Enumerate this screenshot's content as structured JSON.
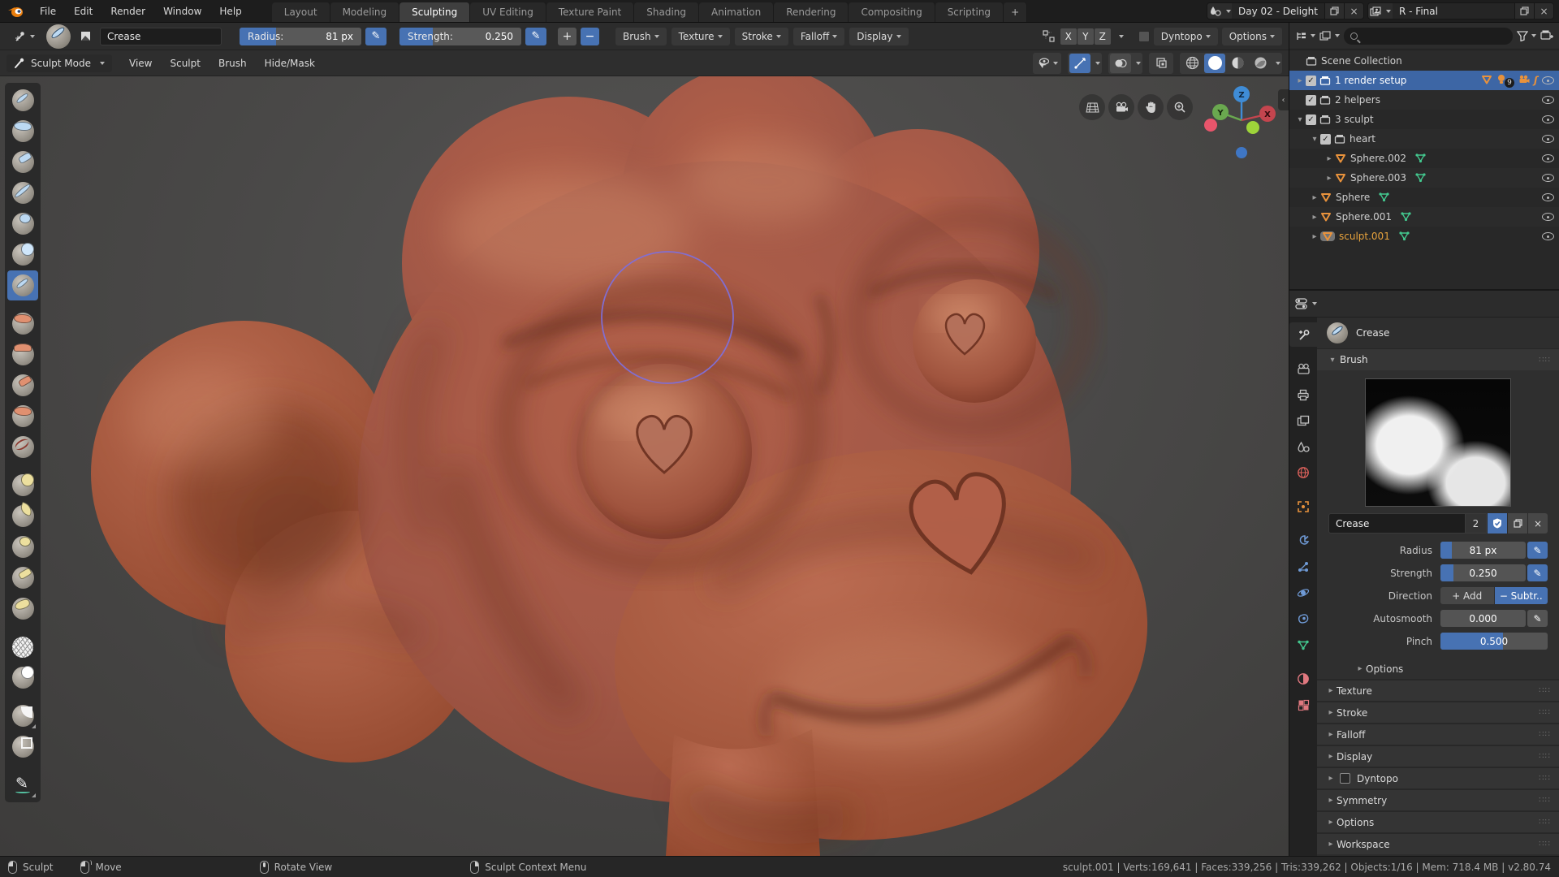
{
  "colors": {
    "accent": "#4772b3",
    "selection_row": "#3d66a5",
    "object_orange": "#e8923c",
    "data_green": "#43c78e",
    "active_text": "#e8a33d",
    "cursor_purple": "#7f6fd8",
    "skin_base": "#a25847",
    "skin_shadow": "#6e3322",
    "skin_light": "#c07a5e"
  },
  "topbar": {
    "menus": [
      "File",
      "Edit",
      "Render",
      "Window",
      "Help"
    ],
    "tabs": [
      {
        "label": "Layout",
        "active": false
      },
      {
        "label": "Modeling",
        "active": false
      },
      {
        "label": "Sculpting",
        "active": true
      },
      {
        "label": "UV Editing",
        "active": false
      },
      {
        "label": "Texture Paint",
        "active": false
      },
      {
        "label": "Shading",
        "active": false
      },
      {
        "label": "Animation",
        "active": false
      },
      {
        "label": "Rendering",
        "active": false
      },
      {
        "label": "Compositing",
        "active": false
      },
      {
        "label": "Scripting",
        "active": false
      }
    ],
    "add_tab_label": "+",
    "scene": {
      "label": "Day 02 - Delight"
    },
    "view_layer": {
      "label": "R - Final"
    }
  },
  "tool_settings": {
    "brush_name": "Crease",
    "radius_label": "Radius:",
    "radius_value": "81 px",
    "radius_fill": 0.3,
    "strength_label": "Strength:",
    "strength_value": "0.250",
    "strength_fill": 0.27,
    "add_label": "+",
    "subtract_label": "−",
    "popovers": [
      "Brush",
      "Texture",
      "Stroke",
      "Falloff",
      "Display"
    ],
    "axis_toggles": [
      "X",
      "Y",
      "Z"
    ],
    "dyntopo_label": "Dyntopo",
    "options_label": "Options"
  },
  "viewport_header": {
    "mode_label": "Sculpt Mode",
    "menus": [
      "View",
      "Sculpt",
      "Brush",
      "Hide/Mask"
    ]
  },
  "toolbar": {
    "tools": [
      {
        "name": "draw",
        "kind": "stripe",
        "color": "#bcd9f2",
        "active": false,
        "gap": false
      },
      {
        "name": "clay",
        "kind": "crumple",
        "color": "#bcd9f2",
        "active": false,
        "gap": false
      },
      {
        "name": "clay-strips",
        "kind": "strips",
        "color": "#bcd9f2",
        "active": false,
        "gap": false
      },
      {
        "name": "layer",
        "kind": "band",
        "color": "#bcd9f2",
        "active": false,
        "gap": false
      },
      {
        "name": "inflate",
        "kind": "blobtop",
        "color": "#bcd9f2",
        "active": false,
        "gap": false
      },
      {
        "name": "blob",
        "kind": "bloright",
        "color": "#cfe6fa",
        "active": false,
        "gap": false
      },
      {
        "name": "crease",
        "kind": "stripe",
        "color": "#bcd9f2",
        "active": true,
        "gap": false
      },
      {
        "name": "smooth",
        "kind": "crumple",
        "color": "#e09070",
        "active": false,
        "gap": true
      },
      {
        "name": "flatten",
        "kind": "cap",
        "color": "#e09070",
        "active": false,
        "gap": false
      },
      {
        "name": "fill",
        "kind": "strips",
        "color": "#e09070",
        "active": false,
        "gap": false
      },
      {
        "name": "scrape",
        "kind": "crumple",
        "color": "#e09070",
        "active": false,
        "gap": false
      },
      {
        "name": "pinch",
        "kind": "lines",
        "color": "#8c3a30",
        "active": false,
        "gap": false
      },
      {
        "name": "grab",
        "kind": "bloright",
        "color": "#ecdf9e",
        "active": false,
        "gap": true
      },
      {
        "name": "snake-hook",
        "kind": "point",
        "color": "#ecdf9e",
        "active": false,
        "gap": false
      },
      {
        "name": "thumb",
        "kind": "blobtop",
        "color": "#ecdf9e",
        "active": false,
        "gap": false
      },
      {
        "name": "nudge",
        "kind": "strips",
        "color": "#ecdf9e",
        "active": false,
        "gap": false
      },
      {
        "name": "rotate",
        "kind": "swirl",
        "color": "#ecdf9e",
        "active": false,
        "gap": false
      },
      {
        "name": "simplify",
        "kind": "web",
        "color": "#f0f0f0",
        "active": false,
        "gap": true
      },
      {
        "name": "mask",
        "kind": "bloright",
        "color": "#ffffff",
        "active": false,
        "gap": false
      },
      {
        "name": "box-hide",
        "kind": "boxfill",
        "color": "#f5f5f5",
        "active": false,
        "gap": true,
        "submenu": true
      },
      {
        "name": "box-mask",
        "kind": "boxline",
        "color": "#f5f5f5",
        "active": false,
        "gap": false
      },
      {
        "name": "annotate",
        "kind": "pen",
        "color": "#54c0a0",
        "active": false,
        "gap": true,
        "submenu": true
      }
    ]
  },
  "gizmo": {
    "x_label": "X",
    "y_label": "Y",
    "z_label": "Z"
  },
  "outliner": {
    "search_placeholder": "",
    "rows": [
      {
        "indent": 0,
        "expander": "",
        "checkbox": false,
        "icon": "collection",
        "label": "Scene Collection",
        "selected": false,
        "active": false,
        "datamesh": false,
        "badges": false,
        "eye": false
      },
      {
        "indent": 0,
        "expander": "right",
        "checkbox": true,
        "icon": "collection",
        "label": "1 render setup",
        "selected": true,
        "active": false,
        "datamesh": false,
        "badges": true,
        "eye": true
      },
      {
        "indent": 0,
        "expander": "",
        "checkbox": true,
        "icon": "collection",
        "label": "2 helpers",
        "selected": false,
        "active": false,
        "datamesh": false,
        "badges": false,
        "eye": true
      },
      {
        "indent": 0,
        "expander": "down",
        "checkbox": true,
        "icon": "collection",
        "label": "3 sculpt",
        "selected": false,
        "active": false,
        "datamesh": false,
        "badges": false,
        "eye": true
      },
      {
        "indent": 1,
        "expander": "down",
        "checkbox": true,
        "icon": "collection",
        "label": "heart",
        "selected": false,
        "active": false,
        "datamesh": false,
        "badges": false,
        "eye": true
      },
      {
        "indent": 2,
        "expander": "right",
        "checkbox": false,
        "icon": "mesh",
        "label": "Sphere.002",
        "selected": false,
        "active": false,
        "datamesh": true,
        "badges": false,
        "eye": true
      },
      {
        "indent": 2,
        "expander": "right",
        "checkbox": false,
        "icon": "mesh",
        "label": "Sphere.003",
        "selected": false,
        "active": false,
        "datamesh": true,
        "badges": false,
        "eye": true
      },
      {
        "indent": 1,
        "expander": "right",
        "checkbox": false,
        "icon": "mesh",
        "label": "Sphere",
        "selected": false,
        "active": false,
        "datamesh": true,
        "badges": false,
        "eye": true
      },
      {
        "indent": 1,
        "expander": "right",
        "checkbox": false,
        "icon": "mesh",
        "label": "Sphere.001",
        "selected": false,
        "active": false,
        "datamesh": true,
        "badges": false,
        "eye": true
      },
      {
        "indent": 1,
        "expander": "right",
        "checkbox": false,
        "icon": "mesh-active",
        "label": "sculpt.001",
        "selected": false,
        "active": true,
        "datamesh": true,
        "badges": false,
        "eye": true
      }
    ],
    "light_badge_count": "9"
  },
  "properties": {
    "breadcrumb": "Crease",
    "tabs": [
      {
        "name": "tool",
        "active": true,
        "color": "#d8d8d8",
        "spaced": false
      },
      {
        "name": "render",
        "active": false,
        "color": "#bfbfbf",
        "spaced": true
      },
      {
        "name": "output",
        "active": false,
        "color": "#bfbfbf",
        "spaced": false
      },
      {
        "name": "view-layer",
        "active": false,
        "color": "#bfbfbf",
        "spaced": false
      },
      {
        "name": "scene",
        "active": false,
        "color": "#bfbfbf",
        "spaced": false
      },
      {
        "name": "world",
        "active": false,
        "color": "#d9605a",
        "spaced": false
      },
      {
        "name": "object",
        "active": false,
        "color": "#e8923c",
        "spaced": true
      },
      {
        "name": "modifiers",
        "active": false,
        "color": "#6f9ad6",
        "spaced": true
      },
      {
        "name": "particles",
        "active": false,
        "color": "#6f9ad6",
        "spaced": false
      },
      {
        "name": "physics",
        "active": false,
        "color": "#6f9ad6",
        "spaced": false
      },
      {
        "name": "constraints",
        "active": false,
        "color": "#6f9ad6",
        "spaced": false
      },
      {
        "name": "object-data",
        "active": false,
        "color": "#43c78e",
        "spaced": false
      },
      {
        "name": "material",
        "active": false,
        "color": "#e0787f",
        "spaced": true
      },
      {
        "name": "texture",
        "active": false,
        "color": "#e0787f",
        "spaced": false
      }
    ],
    "brush_panel": {
      "title": "Brush",
      "name": "Crease",
      "count": "2",
      "fields": [
        {
          "label": "Radius",
          "value": "81 px",
          "fill": 0.13,
          "pen": "blue"
        },
        {
          "label": "Strength",
          "value": "0.250",
          "fill": 0.15,
          "pen": "blue"
        },
        {
          "label": "Autosmooth",
          "value": "0.000",
          "fill": 0,
          "pen": "gray"
        },
        {
          "label": "Pinch",
          "value": "0.500",
          "fill": 0.58,
          "pen": ""
        }
      ],
      "direction": {
        "label": "Direction",
        "add": "Add",
        "subtract": "Subtr..",
        "active": "subtract"
      },
      "options_label": "Options"
    },
    "sections": [
      {
        "label": "Texture",
        "checkbox": false
      },
      {
        "label": "Stroke",
        "checkbox": false
      },
      {
        "label": "Falloff",
        "checkbox": false
      },
      {
        "label": "Display",
        "checkbox": false
      },
      {
        "label": "Dyntopo",
        "checkbox": true
      },
      {
        "label": "Symmetry",
        "checkbox": false
      },
      {
        "label": "Options",
        "checkbox": false
      },
      {
        "label": "Workspace",
        "checkbox": false
      }
    ]
  },
  "statusbar": {
    "hints": [
      {
        "mouse": "left",
        "label": "Sculpt",
        "wide": false
      },
      {
        "mouse": "leftdrag",
        "label": "Move",
        "wide": true
      },
      {
        "mouse": "middle",
        "label": "Rotate View",
        "wide": true
      },
      {
        "mouse": "right",
        "label": "Sculpt Context Menu",
        "wide": false
      }
    ],
    "stats_segments": [
      "sculpt.001",
      "Verts:169,641",
      "Faces:339,256",
      "Tris:339,262",
      "Objects:1/16",
      "Mem: 718.4 MB",
      "v2.80.74"
    ]
  }
}
